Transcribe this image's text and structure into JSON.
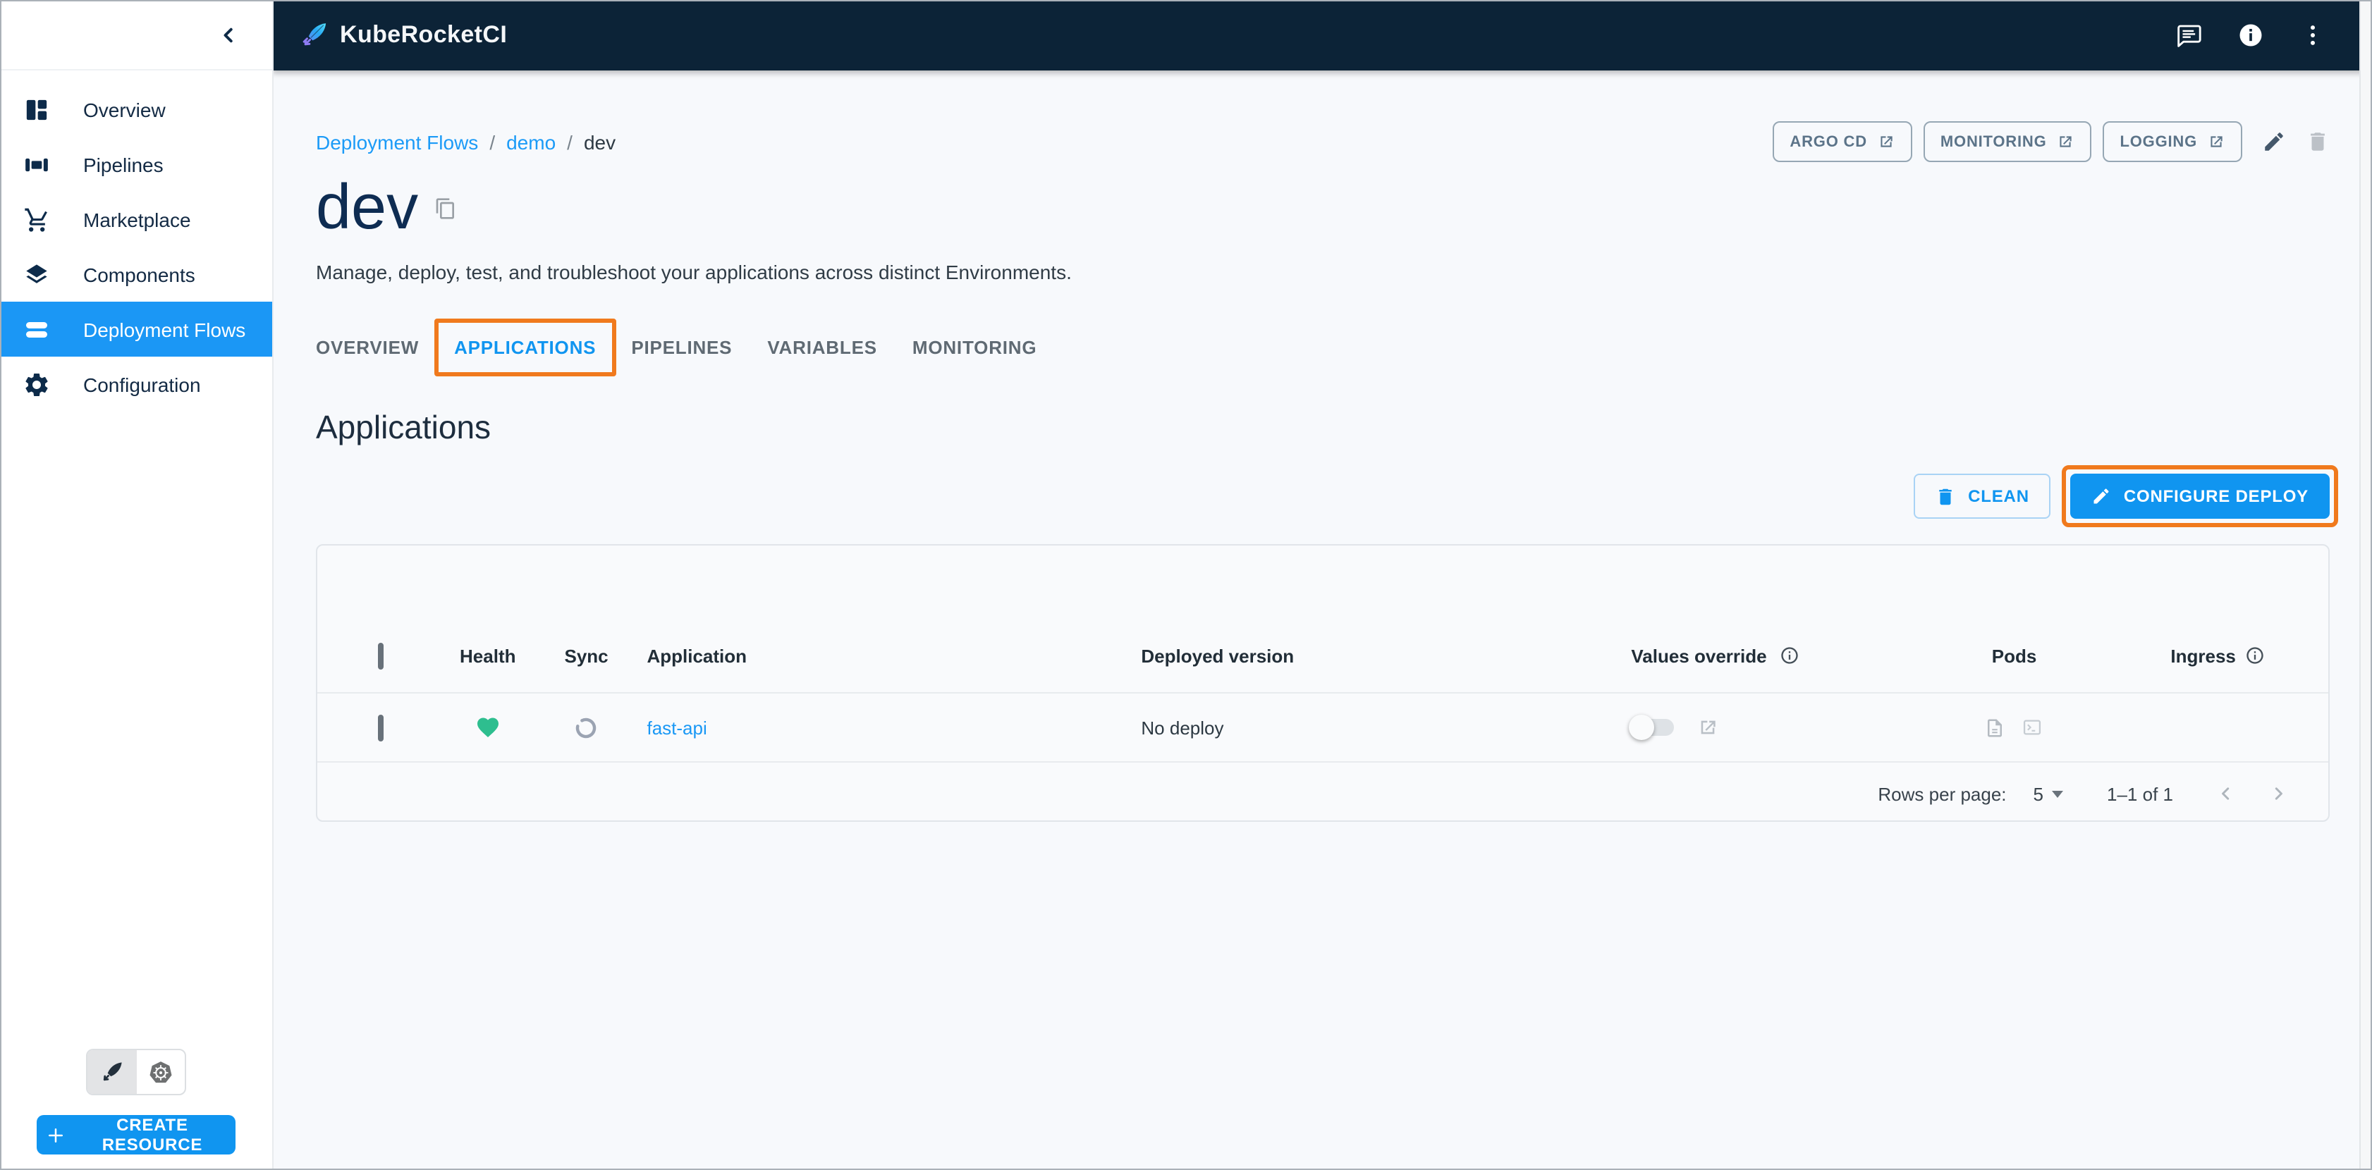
{
  "topbar": {
    "title": "KubeRocketCI",
    "icons": [
      "feedback-chat-icon",
      "info-icon",
      "kebab-menu-icon"
    ]
  },
  "sidebar": {
    "items": [
      {
        "label": "Overview",
        "icon": "dashboard-icon",
        "active": false
      },
      {
        "label": "Pipelines",
        "icon": "pipelines-icon",
        "active": false
      },
      {
        "label": "Marketplace",
        "icon": "cart-icon",
        "active": false
      },
      {
        "label": "Components",
        "icon": "layers-icon",
        "active": false
      },
      {
        "label": "Deployment Flows",
        "icon": "stacked-bars-icon",
        "active": true
      },
      {
        "label": "Configuration",
        "icon": "gear-icon",
        "active": false
      }
    ],
    "theme_toggle": {
      "options": [
        "kuberocketci-theme",
        "kubernetes-theme"
      ],
      "selected": "kuberocketci-theme"
    },
    "create_button_label": "CREATE RESOURCE"
  },
  "header": {
    "breadcrumbs": [
      {
        "label": "Deployment Flows",
        "link": true
      },
      {
        "label": "demo",
        "link": true
      },
      {
        "label": "dev",
        "link": false
      }
    ],
    "title": "dev",
    "description": "Manage, deploy, test, and troubleshoot your applications across distinct Environments.",
    "quick_links": [
      {
        "label": "ARGO CD"
      },
      {
        "label": "MONITORING"
      },
      {
        "label": "LOGGING"
      }
    ]
  },
  "tabs": [
    {
      "label": "OVERVIEW",
      "active": false
    },
    {
      "label": "APPLICATIONS",
      "active": true,
      "annotated": true
    },
    {
      "label": "PIPELINES",
      "active": false
    },
    {
      "label": "VARIABLES",
      "active": false
    },
    {
      "label": "MONITORING",
      "active": false
    }
  ],
  "applications": {
    "section_title": "Applications",
    "clean_button_label": "CLEAN",
    "configure_deploy_button_label": "CONFIGURE DEPLOY",
    "table": {
      "headers": {
        "health": "Health",
        "sync": "Sync",
        "application": "Application",
        "deployed_version": "Deployed version",
        "values_override": "Values override",
        "pods": "Pods",
        "ingress": "Ingress"
      },
      "rows": [
        {
          "application": "fast-api",
          "deployed_version": "No deploy",
          "health": "healthy",
          "sync": "unknown",
          "values_override_enabled": false
        }
      ],
      "pagination": {
        "rows_per_page_label": "Rows per page:",
        "rows_per_page_value": "5",
        "range": "1–1 of 1"
      }
    }
  },
  "colors": {
    "topbar_bg": "#0c2337",
    "primary": "#1095f0",
    "sidebar_active_bg": "#1b97f5",
    "link": "#1c9bf7",
    "healthy_green": "#2ebe8f",
    "annotation_orange": "#f07a1d",
    "page_bg": "#f7f9fc"
  }
}
